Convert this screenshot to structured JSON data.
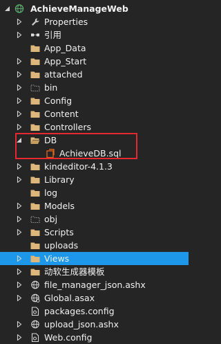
{
  "project": {
    "label": "AchieveManageWeb",
    "icon": "web-project-icon"
  },
  "items": [
    {
      "label": "Properties",
      "icon": "wrench-icon",
      "toggle": "collapsed",
      "indent": 1
    },
    {
      "label": "引用",
      "icon": "references-icon",
      "toggle": "collapsed",
      "indent": 1
    },
    {
      "label": "App_Data",
      "icon": "folder-icon",
      "toggle": "none",
      "indent": 1
    },
    {
      "label": "App_Start",
      "icon": "folder-icon",
      "toggle": "collapsed",
      "indent": 1
    },
    {
      "label": "attached",
      "icon": "folder-icon",
      "toggle": "collapsed",
      "indent": 1
    },
    {
      "label": "bin",
      "icon": "folder-dashed-icon",
      "toggle": "collapsed",
      "indent": 1
    },
    {
      "label": "Config",
      "icon": "folder-icon",
      "toggle": "collapsed",
      "indent": 1
    },
    {
      "label": "Content",
      "icon": "folder-icon",
      "toggle": "collapsed",
      "indent": 1
    },
    {
      "label": "Controllers",
      "icon": "folder-icon",
      "toggle": "collapsed",
      "indent": 1
    },
    {
      "label": "DB",
      "icon": "folder-open-icon",
      "toggle": "expanded",
      "indent": 1
    },
    {
      "label": "AchieveDB.sql",
      "icon": "sql-file-icon",
      "toggle": "none",
      "indent": 2
    },
    {
      "label": "kindeditor-4.1.3",
      "icon": "folder-icon",
      "toggle": "collapsed",
      "indent": 1
    },
    {
      "label": "Library",
      "icon": "folder-icon",
      "toggle": "collapsed",
      "indent": 1
    },
    {
      "label": "log",
      "icon": "folder-icon",
      "toggle": "none",
      "indent": 1
    },
    {
      "label": "Models",
      "icon": "folder-icon",
      "toggle": "collapsed",
      "indent": 1
    },
    {
      "label": "obj",
      "icon": "folder-dashed-icon",
      "toggle": "collapsed",
      "indent": 1
    },
    {
      "label": "Scripts",
      "icon": "folder-icon",
      "toggle": "collapsed",
      "indent": 1
    },
    {
      "label": "uploads",
      "icon": "folder-icon",
      "toggle": "none",
      "indent": 1
    },
    {
      "label": "Views",
      "icon": "folder-icon",
      "toggle": "collapsed",
      "indent": 1,
      "selected": true
    },
    {
      "label": "动软生成器模板",
      "icon": "folder-icon",
      "toggle": "collapsed",
      "indent": 1
    },
    {
      "label": "file_manager_json.ashx",
      "icon": "ashx-file-icon",
      "toggle": "collapsed",
      "indent": 1
    },
    {
      "label": "Global.asax",
      "icon": "global-asax-icon",
      "toggle": "collapsed",
      "indent": 1
    },
    {
      "label": "packages.config",
      "icon": "config-file-icon",
      "toggle": "none",
      "indent": 1
    },
    {
      "label": "upload_json.ashx",
      "icon": "ashx-file-icon",
      "toggle": "collapsed",
      "indent": 1
    },
    {
      "label": "Web.config",
      "icon": "config-file-icon",
      "toggle": "collapsed",
      "indent": 1
    }
  ],
  "colors": {
    "background": "#252526",
    "text": "#f1f1f1",
    "selection": "#1c97ea",
    "folder": "#dcb67a",
    "sql_icon": "#e8661c",
    "highlight_border": "#e6282f"
  }
}
